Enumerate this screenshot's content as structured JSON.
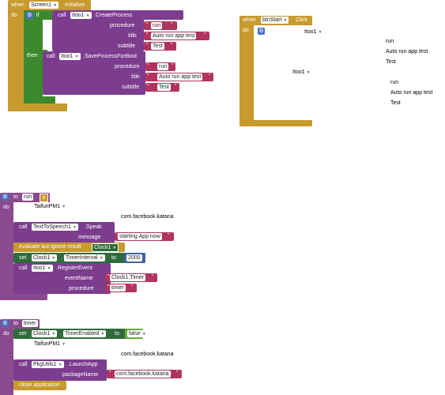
{
  "labels": {
    "when": "when",
    "do": "do",
    "if": "if",
    "then": "then",
    "call": "call",
    "set": "set",
    "to": "to",
    "dot": ".",
    "evaluate_ignore": "evaluate but ignore result",
    "close_app": "close application"
  },
  "block1": {
    "component": "Screen1",
    "event": "Initialize",
    "if_call": {
      "component": "Itoo1",
      "method": "CreateProcess",
      "params": [
        {
          "name": "procedure",
          "value": "run"
        },
        {
          "name": "title",
          "value": "Auto run app test"
        },
        {
          "name": "subtitle",
          "value": "Test"
        }
      ]
    },
    "then_call": {
      "component": "Itoo1",
      "method": "SaveProcessForBoot",
      "params": [
        {
          "name": "procedure",
          "value": "run"
        },
        {
          "name": "title",
          "value": "Auto run app test"
        },
        {
          "name": "subtitle",
          "value": "Test"
        }
      ]
    }
  },
  "block2": {
    "component": "btnStart",
    "event": "Click",
    "c1_label": "Itoo1",
    "c1_lines": [
      "run",
      "Auto run app test",
      "Test"
    ],
    "c2_label": "Itoo1",
    "c2_lines": [
      "run",
      "Auto run app test",
      "Test"
    ]
  },
  "block3": {
    "proc_name": "run",
    "collapsed_label": "TaifunPM1",
    "collapsed_text": "com.facebook.katana",
    "speak": {
      "component": "TextToSpeech1",
      "method": "Speak",
      "param": "message",
      "value": "starting App now"
    },
    "evaluate_component": "Clock1",
    "set_component": "Clock1",
    "set_property": "TimerInterval",
    "set_value": "2000",
    "register": {
      "component": "Itoo1",
      "method": "RegisterEvent",
      "params": [
        {
          "name": "eventName",
          "value": "Clock1.Timer"
        },
        {
          "name": "procedure",
          "value": "timer"
        }
      ]
    }
  },
  "block4": {
    "proc_name": "timer",
    "set_component": "Clock1",
    "set_property": "TimerEnabled",
    "set_value": "false",
    "collapsed_label": "TaifunPM1",
    "collapsed_text": "com.facebook.katana",
    "launch": {
      "component": "PkgUtils1",
      "method": "LaunchApp",
      "param": "packageName",
      "value": "com.facebook.katana"
    }
  },
  "colors": {
    "event": "#c79a2e",
    "component": "#7c3d8e",
    "text": "#b0345f",
    "control": "#3d8a2e",
    "procedure": "#8a4a8e",
    "number": "#3e62a6"
  }
}
